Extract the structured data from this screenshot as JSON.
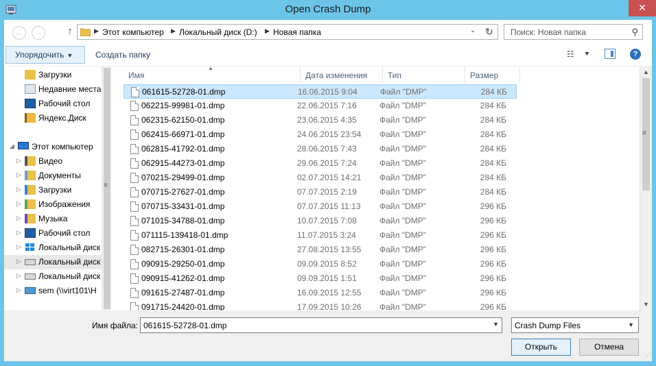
{
  "window": {
    "title": "Open Crash Dump",
    "close_label": "✕"
  },
  "nav": {
    "back_icon": "←",
    "forward_icon": "→",
    "up_icon": "↑",
    "breadcrumbs": [
      "Этот компьютер",
      "Локальный диск (D:)",
      "Новая папка"
    ],
    "separator": "▶",
    "dropdown_icon": "⌄",
    "refresh_icon": "↻"
  },
  "search": {
    "placeholder": "Поиск: Новая папка",
    "icon": "⚲"
  },
  "toolbar": {
    "organize_label": "Упорядочить",
    "organize_arrow": "▼",
    "new_folder_label": "Создать папку",
    "views_icon": "☷",
    "views_arrow": "▼",
    "help_label": "?"
  },
  "tree": {
    "items": [
      {
        "label": "Загрузки",
        "icon": "downloads-folder-icon"
      },
      {
        "label": "Недавние места",
        "icon": "recent-places-icon"
      },
      {
        "label": "Рабочий стол",
        "icon": "desktop-icon"
      },
      {
        "label": "Яндекс.Диск",
        "icon": "yandex-disk-icon"
      },
      {
        "label": "Этот компьютер",
        "icon": "computer-icon",
        "expander": "◢"
      },
      {
        "label": "Видео",
        "icon": "video-folder-icon",
        "expander": "▷"
      },
      {
        "label": "Документы",
        "icon": "documents-folder-icon",
        "expander": "▷"
      },
      {
        "label": "Загрузки",
        "icon": "downloads-folder-icon",
        "expander": "▷"
      },
      {
        "label": "Изображения",
        "icon": "pictures-folder-icon",
        "expander": "▷"
      },
      {
        "label": "Музыка",
        "icon": "music-folder-icon",
        "expander": "▷"
      },
      {
        "label": "Рабочий стол",
        "icon": "desktop-icon",
        "expander": "▷"
      },
      {
        "label": "Локальный диск",
        "icon": "windows-drive-icon",
        "expander": "▷"
      },
      {
        "label": "Локальный диск",
        "icon": "drive-icon",
        "expander": "▷"
      },
      {
        "label": "Локальный диск",
        "icon": "drive-icon",
        "expander": "▷"
      },
      {
        "label": "sem (\\\\virt101\\H",
        "icon": "network-drive-icon",
        "expander": "▷"
      }
    ],
    "grip": "≡"
  },
  "columns": {
    "name": "Имя",
    "date": "Дата изменения",
    "type": "Тип",
    "size": "Размер",
    "sort_arrow": "▲"
  },
  "files": [
    {
      "name": "061615-52728-01.dmp",
      "date": "16.06.2015 9:04",
      "type": "Файл \"DMP\"",
      "size": "284 КБ"
    },
    {
      "name": "062215-99981-01.dmp",
      "date": "22.06.2015 7:16",
      "type": "Файл \"DMP\"",
      "size": "284 КБ"
    },
    {
      "name": "062315-62150-01.dmp",
      "date": "23.06.2015 4:35",
      "type": "Файл \"DMP\"",
      "size": "284 КБ"
    },
    {
      "name": "062415-66971-01.dmp",
      "date": "24.06.2015 23:54",
      "type": "Файл \"DMP\"",
      "size": "284 КБ"
    },
    {
      "name": "062815-41792-01.dmp",
      "date": "28.06.2015 7:43",
      "type": "Файл \"DMP\"",
      "size": "284 КБ"
    },
    {
      "name": "062915-44273-01.dmp",
      "date": "29.06.2015 7:24",
      "type": "Файл \"DMP\"",
      "size": "284 КБ"
    },
    {
      "name": "070215-29499-01.dmp",
      "date": "02.07.2015 14:21",
      "type": "Файл \"DMP\"",
      "size": "284 КБ"
    },
    {
      "name": "070715-27627-01.dmp",
      "date": "07.07.2015 2:19",
      "type": "Файл \"DMP\"",
      "size": "284 КБ"
    },
    {
      "name": "070715-33431-01.dmp",
      "date": "07.07.2015 11:13",
      "type": "Файл \"DMP\"",
      "size": "296 КБ"
    },
    {
      "name": "071015-34788-01.dmp",
      "date": "10.07.2015 7:08",
      "type": "Файл \"DMP\"",
      "size": "296 КБ"
    },
    {
      "name": "071115-139418-01.dmp",
      "date": "11.07.2015 3:24",
      "type": "Файл \"DMP\"",
      "size": "296 КБ"
    },
    {
      "name": "082715-26301-01.dmp",
      "date": "27.08.2015 13:55",
      "type": "Файл \"DMP\"",
      "size": "296 КБ"
    },
    {
      "name": "090915-29250-01.dmp",
      "date": "09.09.2015 8:52",
      "type": "Файл \"DMP\"",
      "size": "296 КБ"
    },
    {
      "name": "090915-41262-01.dmp",
      "date": "09.09.2015 1:51",
      "type": "Файл \"DMP\"",
      "size": "296 КБ"
    },
    {
      "name": "091615-27487-01.dmp",
      "date": "16.09.2015 12:55",
      "type": "Файл \"DMP\"",
      "size": "296 КБ"
    },
    {
      "name": "091715-24420-01.dmp",
      "date": "17.09.2015 10:26",
      "type": "Файл \"DMP\"",
      "size": "296 КБ"
    }
  ],
  "list_scroll": {
    "up": "▲",
    "down": "▼",
    "grip": "≡"
  },
  "bottom": {
    "filename_label": "Имя файла:",
    "filename_value": "061615-52728-01.dmp",
    "filename_dd": "▼",
    "filter_value": "Crash Dump Files",
    "filter_dd": "▼",
    "open_label": "Открыть",
    "cancel_label": "Отмена",
    "resize_grip": "⋰"
  }
}
